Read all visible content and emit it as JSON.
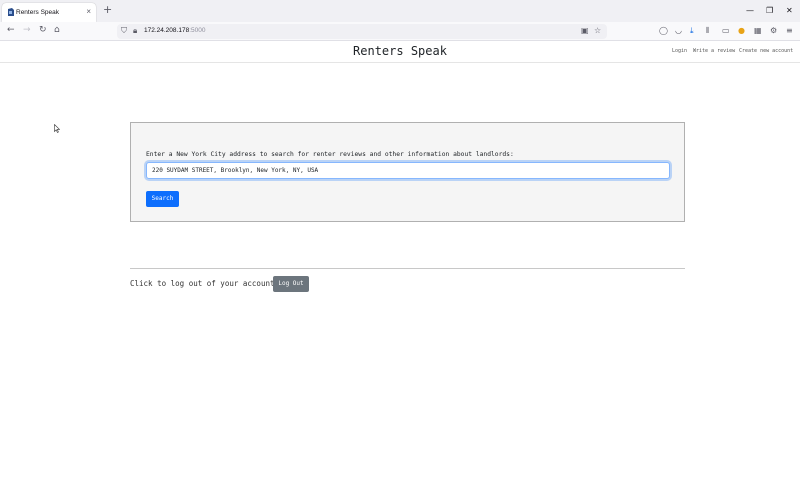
{
  "browser": {
    "tab_title": "Renters Speak",
    "tab_close": "×",
    "new_tab": "+",
    "url_host": "172.24.208.178",
    "url_port": ":5000",
    "controls": {
      "minimize": "—",
      "maximize": "❐",
      "close": "✕"
    }
  },
  "header": {
    "title": "Renters Speak",
    "links": {
      "login": "Login",
      "write_review": "Write a review",
      "create_account": "Create new account"
    }
  },
  "search": {
    "label": "Enter a New York City address to search for renter reviews and other information about landlords:",
    "value": "220 SUYDAM STREET, Brooklyn, New York, NY, USA",
    "button": "Search"
  },
  "logout": {
    "label": "Click to log out of your account:",
    "button": "Log Out"
  },
  "colors": {
    "primary_button": "#0d6efd",
    "secondary_button": "#6c757d",
    "card_background": "#f5f5f5",
    "input_focus_border": "#86b7fe"
  }
}
